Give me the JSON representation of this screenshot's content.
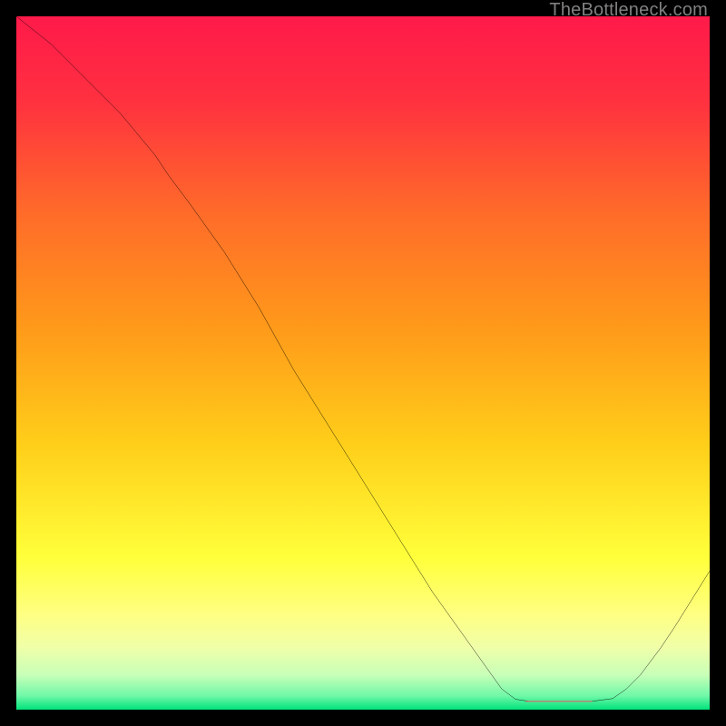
{
  "watermark": {
    "text": "TheBottleneck.com"
  },
  "colors": {
    "grad_top": "#ff1a4a",
    "grad_mid1": "#ff6a2a",
    "grad_mid2": "#ffd21a",
    "grad_yellow": "#ffff3a",
    "grad_pale": "#f4ffc0",
    "grad_green": "#00e27a",
    "curve": "#000000",
    "marker": "#d86a6a"
  },
  "chart_data": {
    "type": "line",
    "title": "",
    "xlabel": "",
    "ylabel": "",
    "xlim": [
      0,
      100
    ],
    "ylim": [
      0,
      100
    ],
    "grid": false,
    "legend": false,
    "series": [
      {
        "name": "bottleneck-curve",
        "x": [
          0,
          5,
          10,
          15,
          20,
          25,
          30,
          35,
          40,
          45,
          50,
          55,
          60,
          65,
          70,
          72,
          76,
          80,
          83,
          86,
          90,
          95,
          100
        ],
        "y": [
          100,
          96,
          91,
          86,
          80,
          75,
          66,
          58,
          49,
          41,
          33,
          25,
          17,
          10,
          3,
          1.5,
          1.2,
          1.2,
          1.2,
          1.6,
          5,
          12,
          20
        ]
      }
    ],
    "annotations": [
      {
        "name": "optimal-range-marker",
        "x_start": 73.5,
        "x_end": 83,
        "y": 1.2
      }
    ],
    "gradient_stops": [
      {
        "pos": 0.0,
        "color": "#ff1a4a"
      },
      {
        "pos": 0.4,
        "color": "#ff8a2a"
      },
      {
        "pos": 0.7,
        "color": "#ffd21a"
      },
      {
        "pos": 0.86,
        "color": "#ffff6a"
      },
      {
        "pos": 0.93,
        "color": "#e8ffb0"
      },
      {
        "pos": 0.985,
        "color": "#7dffb0"
      },
      {
        "pos": 1.0,
        "color": "#00e27a"
      }
    ]
  }
}
